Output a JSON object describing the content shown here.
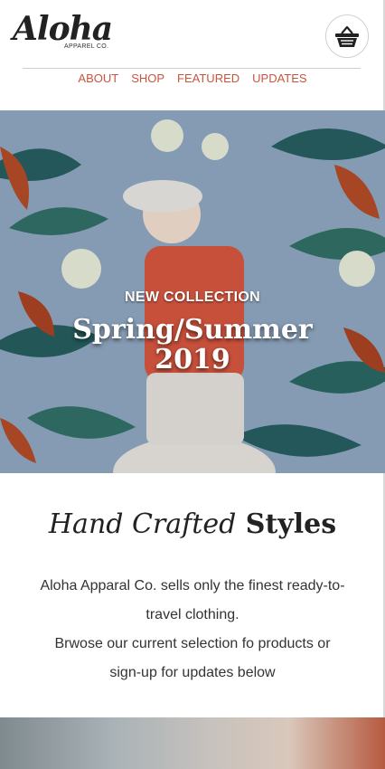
{
  "brand": {
    "name": "Aloha",
    "subtitle": "APPAREL CO."
  },
  "nav": {
    "items": [
      "ABOUT",
      "SHOP",
      "FEATURED",
      "UPDATES"
    ]
  },
  "hero": {
    "kicker": "NEW COLLECTION",
    "title_line1": "Spring/Summer",
    "title_line2": "2019"
  },
  "intro": {
    "heading_italic": "Hand Crafted",
    "heading_bold": "Styles",
    "lines": [
      "Aloha Apparal Co. sells only the finest ready-to-",
      "travel clothing.",
      "Brwose our current selection fo products or",
      "sign-up for updates below"
    ]
  },
  "colors": {
    "accent": "#c8553d",
    "text": "#333333"
  },
  "icons": {
    "cart": "basket-icon"
  }
}
